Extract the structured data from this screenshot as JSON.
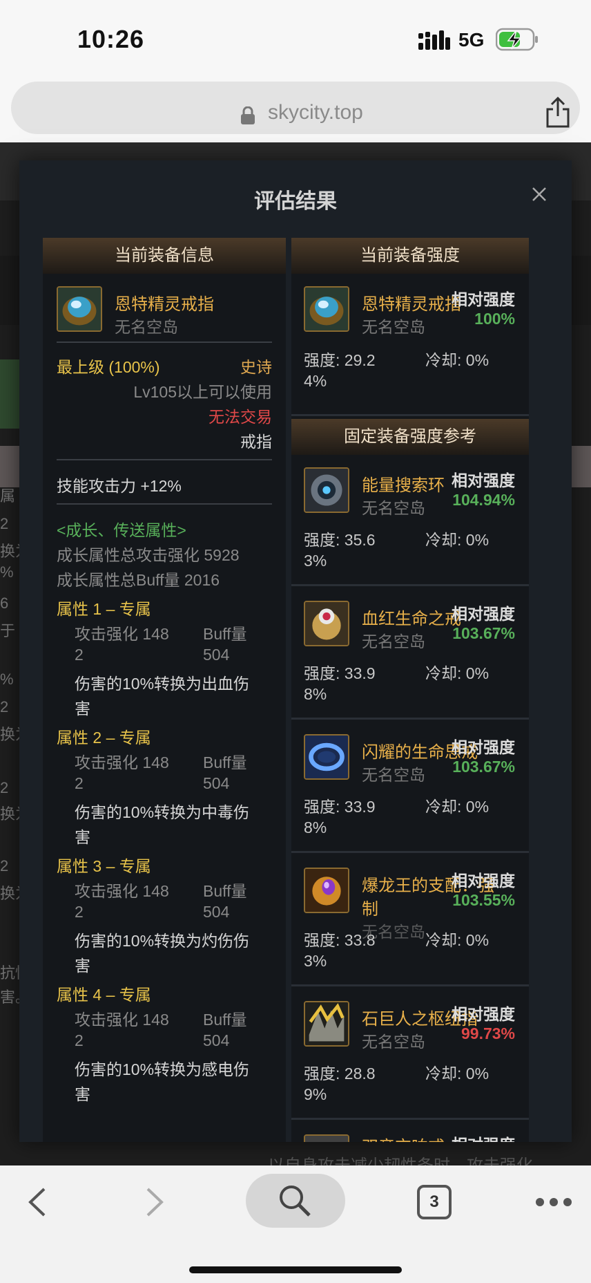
{
  "status_bar": {
    "time": "10:26",
    "network": "5G"
  },
  "url_bar": {
    "url": "skycity.top"
  },
  "modal": {
    "title": "评估结果",
    "left_panel": {
      "header": "当前装备信息",
      "item": {
        "name": "恩特精灵戒指",
        "server": "无名空岛"
      },
      "grade": "最上级 (100%)",
      "rarity": "史诗",
      "level_req": "Lv105以上可以使用",
      "trade": "无法交易",
      "slot": "戒指",
      "skill_atk": "技能攻击力  +12%",
      "growth_header": "<成长、传送属性>",
      "growth_atk": "成长属性总攻击强化 5928",
      "growth_buff": "成长属性总Buff量 2016",
      "attributes": [
        {
          "title": "属性 1 – 专属",
          "atk_a": "攻击强化   148",
          "atk_b": "2",
          "buff_a": "Buff量",
          "buff_b": "504",
          "desc_a": "伤害的10%转换为出血伤",
          "desc_b": "害"
        },
        {
          "title": "属性 2 – 专属",
          "atk_a": "攻击强化   148",
          "atk_b": "2",
          "buff_a": "Buff量",
          "buff_b": "504",
          "desc_a": "伤害的10%转换为中毒伤",
          "desc_b": "害"
        },
        {
          "title": "属性 3 – 专属",
          "atk_a": "攻击强化   148",
          "atk_b": "2",
          "buff_a": "Buff量",
          "buff_b": "504",
          "desc_a": "伤害的10%转换为灼伤伤",
          "desc_b": "害"
        },
        {
          "title": "属性 4 – 专属",
          "atk_a": "攻击强化   148",
          "atk_b": "2",
          "buff_a": "Buff量",
          "buff_b": "504",
          "desc_a": "伤害的10%转换为感电伤",
          "desc_b": "害"
        }
      ]
    },
    "right_panel": {
      "header": "当前装备强度",
      "current": {
        "name": "恩特精灵戒指",
        "server": "无名空岛",
        "rel_label": "相对强度",
        "rel_value": "100%",
        "strength_a": "强度: 29.2",
        "strength_b": "4%",
        "cooldown": "冷却: 0%"
      },
      "ref_header": "固定装备强度参考",
      "refs": [
        {
          "name": "能量搜索环",
          "server": "无名空岛",
          "rel_label": "相对强度",
          "rel_value": "104.94%",
          "strength_a": "强度: 35.6",
          "strength_b": "3%",
          "cooldown": "冷却: 0%",
          "color": "#58b05a"
        },
        {
          "name": "血红生命之戒",
          "server": "无名空岛",
          "rel_label": "相对强度",
          "rel_value": "103.67%",
          "strength_a": "强度: 33.9",
          "strength_b": "8%",
          "cooldown": "冷却: 0%",
          "color": "#58b05a"
        },
        {
          "name": "闪耀的生命思戒",
          "server": "无名空岛",
          "rel_label": "相对强度",
          "rel_value": "103.67%",
          "strength_a": "强度: 33.9",
          "strength_b": "8%",
          "cooldown": "冷却: 0%",
          "color": "#58b05a"
        },
        {
          "name": "爆龙王的支配：强",
          "name_b": "制",
          "server": "无名空岛",
          "rel_label": "相对强度",
          "rel_value": "103.55%",
          "strength_a": "强度: 33.8",
          "strength_b": "3%",
          "cooldown": "冷却: 0%",
          "color": "#58b05a"
        },
        {
          "name": "石巨人之枢纽指",
          "server": "无名空岛",
          "rel_label": "相对强度",
          "rel_value": "99.73%",
          "strength_a": "强度: 28.8",
          "strength_b": "9%",
          "cooldown": "冷却: 0%",
          "color": "#e04848"
        },
        {
          "name": "双音交响戒",
          "rel_label": "相对强度"
        }
      ]
    }
  },
  "background": {
    "left_fragments": [
      "属",
      "2",
      "换为",
      "%",
      "6",
      "于",
      "%",
      "2",
      "换为",
      "2",
      "换为",
      "2",
      "换为",
      "抗性",
      "害。"
    ],
    "bottom_line": "以自身攻击减少韧性条时，攻击强化"
  },
  "bottom_bar": {
    "tab_count": "3"
  }
}
